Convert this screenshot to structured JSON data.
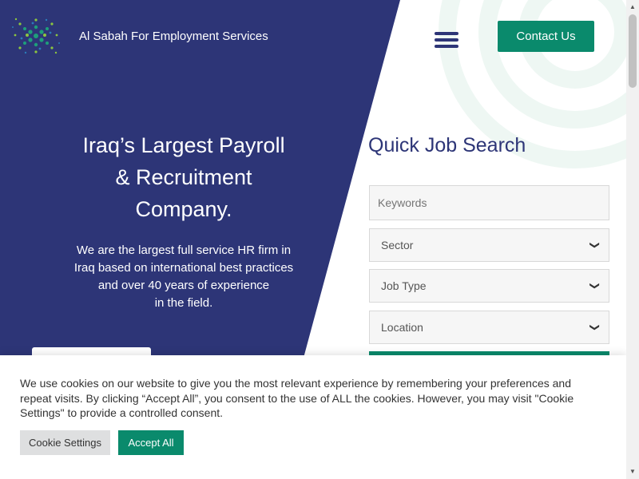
{
  "header": {
    "site_name": "Al Sabah For Employment Services",
    "contact_label": "Contact Us"
  },
  "hero": {
    "title_lines": [
      "Iraq’s Largest Payroll",
      "& Recruitment",
      "Company."
    ],
    "text_lines": [
      "We are the largest full service HR firm in",
      "Iraq based on international best practices",
      "and over 40 years of experience",
      "in the field."
    ]
  },
  "job_search": {
    "title": "Quick Job Search",
    "keywords_placeholder": "Keywords",
    "sector_selected": "Sector",
    "job_type_selected": "Job Type",
    "location_selected": "Location"
  },
  "cookie": {
    "text": "We use cookies on our website to give you the most relevant experience by remembering your preferences and repeat visits. By clicking “Accept All”, you consent to the use of ALL the cookies. However, you may visit \"Cookie Settings\" to provide a controlled consent.",
    "settings_label": "Cookie Settings",
    "accept_label": "Accept All"
  },
  "colors": {
    "navy": "#2d3577",
    "accent_green": "#0a8a6c",
    "circle_tint": "#eef7f3"
  },
  "icons": {
    "logo": "starburst-dots-logo",
    "menu": "hamburger-icon",
    "select": "chevron-down-icon"
  }
}
